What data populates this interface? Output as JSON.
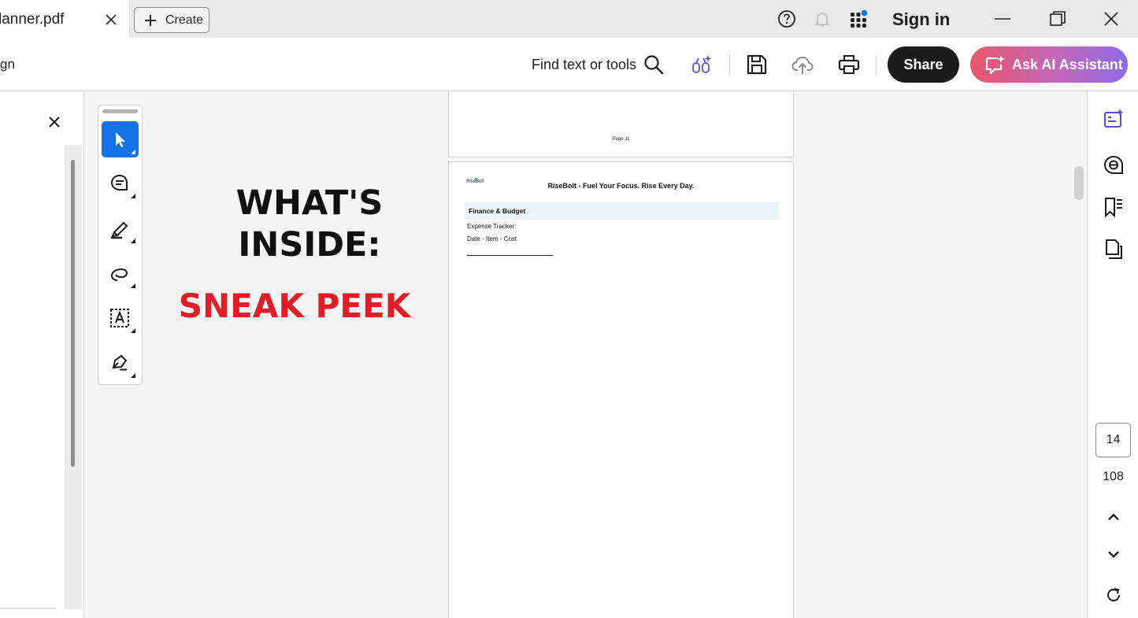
{
  "tab": {
    "title": "lanner.pdf"
  },
  "tabbar": {
    "create_label": "Create",
    "signin_label": "Sign in"
  },
  "toolbar": {
    "menu_fragment": "gn",
    "find_label": "Find text or tools",
    "share_label": "Share",
    "ai_label": "Ask AI Assistant"
  },
  "promo": {
    "title_line1": "WHAT'S",
    "title_line2": "INSIDE:",
    "subtitle": "SNEAK PEEK"
  },
  "document": {
    "prev_page_label": "Page 11",
    "logo_text": "RiseBolt",
    "header": "RiseBolt - Fuel Your Focus. Rise Every Day.",
    "section_title": "Finance & Budget",
    "line1": "Expense Tracker:",
    "line2": "Date - Item - Cost"
  },
  "pager": {
    "current": "14",
    "total": "108"
  },
  "colors": {
    "accent": "#1473e6",
    "promo_red": "#e41c26",
    "ai_gradient_start": "#e8576b",
    "ai_gradient_end": "#8f6be8",
    "ai_icon": "#6f5bd3",
    "notification_dot": "#1473e6"
  },
  "icons": {
    "tab_close": "close-icon",
    "create": "plus-icon",
    "help": "help-icon",
    "bell": "bell-icon",
    "apps": "apps-grid-icon",
    "minimize": "minimize-icon",
    "restore": "restore-icon",
    "window_close": "close-icon",
    "search": "search-icon",
    "ai_tools": "ai-tools-icon",
    "save": "save-icon",
    "upload": "cloud-upload-icon",
    "print": "print-icon",
    "ai_chat": "ai-chat-icon"
  }
}
